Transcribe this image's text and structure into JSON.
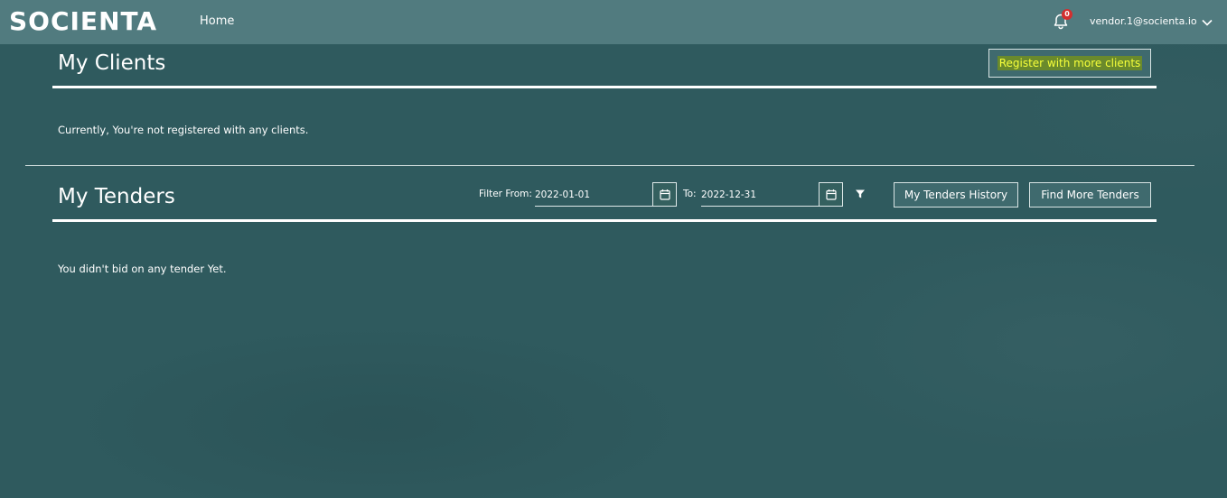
{
  "navbar": {
    "logo": "SOCIENTA",
    "home_label": "Home",
    "notification_count": "0",
    "user_email": "vendor.1@socienta.io",
    "icons": {
      "notifications": "bell-icon",
      "user_menu": "chevron-down-icon"
    }
  },
  "clients": {
    "title": "My Clients",
    "register_button": "Register with more clients",
    "empty_message": "Currently, You're not registered with any clients."
  },
  "tenders": {
    "title": "My Tenders",
    "filter_from_label": "Filter From:",
    "filter_from_value": "2022-01-01",
    "filter_to_label": "To:",
    "filter_to_value": "2022-12-31",
    "history_button": "My Tenders History",
    "find_button": "Find More Tenders",
    "empty_message": "You didn't bid on any tender Yet.",
    "icons": {
      "date_picker": "calendar-icon",
      "filter": "filter-icon"
    }
  },
  "colors": {
    "navbar": "#517b7f",
    "background": "#2f5a5e",
    "highlight_text": "#f7ff3a",
    "badge": "#d32f2f"
  }
}
